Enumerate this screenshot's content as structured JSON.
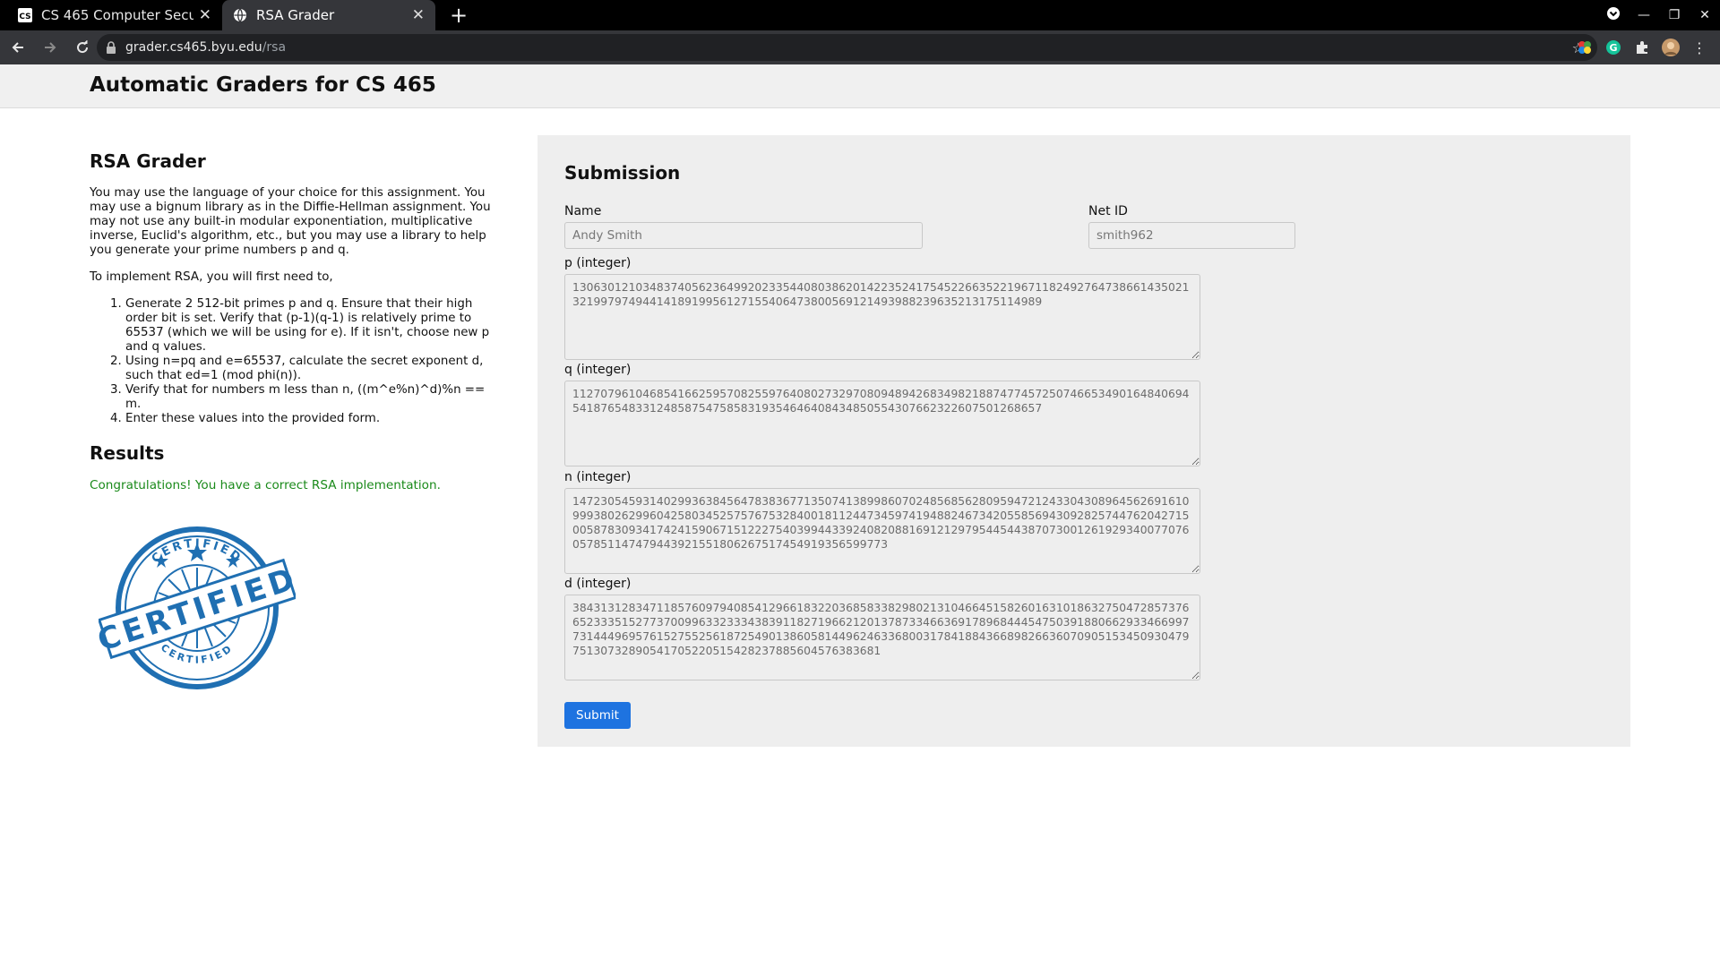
{
  "browser": {
    "tabs": [
      {
        "favicon": "CS",
        "title": "CS 465 Computer Security"
      },
      {
        "favicon": "globe-icon",
        "title": "RSA Grader"
      }
    ],
    "url": {
      "host": "grader.cs465.byu.edu",
      "path": "/rsa"
    }
  },
  "site": {
    "title": "Automatic Graders for CS 465"
  },
  "info": {
    "heading": "RSA Grader",
    "intro": "You may use the language of your choice for this assignment. You may use a bignum library as in the Diffie-Hellman assignment. You may not use any built-in modular exponentiation, multiplicative inverse, Euclid's algorithm, etc., but you may use a library to help you generate your prime numbers p and q.",
    "lead": "To implement RSA, you will first need to,",
    "steps": [
      "Generate 2 512-bit primes p and q. Ensure that their high order bit is set. Verify that (p-1)(q-1) is relatively prime to 65537 (which we will be using for e). If it isn't, choose new p and q values.",
      "Using n=pq and e=65537, calculate the secret exponent d, such that ed=1 (mod phi(n)).",
      "Verify that for numbers m less than n, ((m^e%n)^d)%n == m.",
      "Enter these values into the provided form."
    ],
    "results_heading": "Results",
    "result_message": "Congratulations! You have a correct RSA implementation.",
    "badge": {
      "main": "CERTIFIED",
      "ring_top": "CERTIFIED",
      "ring_bottom": "CERTIFIED"
    }
  },
  "form": {
    "heading": "Submission",
    "name_label": "Name",
    "name_value": "Andy Smith",
    "netid_label": "Net ID",
    "netid_value": "smith962",
    "p_label": "p (integer)",
    "p_value": "13063012103483740562364992023354408038620142235241754522663522196711824927647386614350213219979749441418919956127155406473800569121493988239635213175114989",
    "q_label": "q (integer)",
    "q_value": "11270796104685416625957082559764080273297080948942683498218874774572507466534901648406945418765483312485875475858319354646408434850554307662322607501268657",
    "n_label": "n (integer)",
    "n_value": "147230545931402993638456478383677135074138998607024856856280959472124330430896456269161099938026299604258034525757675328400181124473459741948824673420558569430928257447620427150058783093417424159067151222754039944339240820881691212979544544387073001261929340077076057851147479443921551806267517454919356599773",
    "d_label": "d (integer)",
    "d_value": "38431312834711857609794085412966183220368583382980213104664515826016310186327504728573766523335152773700996332333438391182719662120137873346636917896844454750391880662933466997731444969576152755256187254901386058144962463368003178418843668982663607090515345093047975130732890541705220515428237885604576383681",
    "submit_label": "Submit"
  }
}
